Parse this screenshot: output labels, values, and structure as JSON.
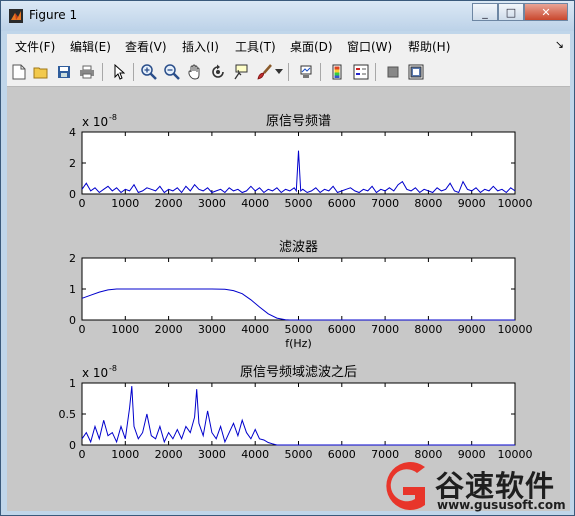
{
  "window": {
    "title": "Figure 1",
    "buttons": {
      "minimize": "_",
      "maximize": "□",
      "close": "✕"
    }
  },
  "menu": {
    "items": [
      "文件(F)",
      "编辑(E)",
      "查看(V)",
      "插入(I)",
      "工具(T)",
      "桌面(D)",
      "窗口(W)",
      "帮助(H)"
    ],
    "dock": "↘"
  },
  "toolbar": {
    "icons": [
      "new-figure-icon",
      "open-file-icon",
      "save-icon",
      "print-icon",
      "pointer-icon",
      "zoom-in-icon",
      "zoom-out-icon",
      "pan-hand-icon",
      "rotate-3d-icon",
      "data-cursor-icon",
      "brush-icon",
      "brush-dropdown-icon",
      "link-plot-icon",
      "colorbar-icon",
      "legend-icon",
      "hide-plot-tools-icon",
      "show-plot-tools-icon"
    ]
  },
  "colors": {
    "plot_line": "#0000cc",
    "background": "#c8c8c8",
    "axes_bg": "#ffffff"
  },
  "watermark": {
    "name": "谷速软件",
    "url": "www.gususoft.com"
  },
  "chart_data": [
    {
      "type": "line",
      "title": "原信号频谱",
      "xlabel": "",
      "ylabel": "",
      "exponent_label": "x 10",
      "exponent": "-8",
      "xlim": [
        0,
        10000
      ],
      "ylim": [
        0,
        4
      ],
      "xticks": [
        0,
        1000,
        2000,
        3000,
        4000,
        5000,
        6000,
        7000,
        8000,
        9000,
        10000
      ],
      "yticks": [
        0,
        2,
        4
      ],
      "series": [
        {
          "x": [
            0,
            100,
            200,
            300,
            400,
            500,
            600,
            700,
            800,
            900,
            1000,
            1100,
            1200,
            1300,
            1400,
            1500,
            1600,
            1700,
            1800,
            1900,
            2000,
            2100,
            2200,
            2300,
            2400,
            2500,
            2600,
            2700,
            2800,
            2900,
            3000,
            3100,
            3200,
            3300,
            3400,
            3500,
            3600,
            3700,
            3800,
            3900,
            4000,
            4100,
            4200,
            4300,
            4400,
            4500,
            4600,
            4700,
            4800,
            4900,
            4950,
            5000,
            5050,
            5100,
            5200,
            5300,
            5400,
            5500,
            5600,
            5700,
            5800,
            5900,
            6000,
            6100,
            6200,
            6300,
            6400,
            6500,
            6600,
            6700,
            6800,
            6900,
            7000,
            7100,
            7200,
            7300,
            7400,
            7500,
            7600,
            7700,
            7800,
            7900,
            8000,
            8100,
            8200,
            8300,
            8400,
            8500,
            8600,
            8700,
            8800,
            8900,
            9000,
            9100,
            9200,
            9300,
            9400,
            9500,
            9600,
            9700,
            9800,
            9900,
            10000
          ],
          "values": [
            0.3,
            0.7,
            0.2,
            0.4,
            0.1,
            0.3,
            0.5,
            0.2,
            0.4,
            0.1,
            0.3,
            0.2,
            0.6,
            0.1,
            0.2,
            0.4,
            0.3,
            0.2,
            0.5,
            0.1,
            0.3,
            0.2,
            0.4,
            0.1,
            0.5,
            0.2,
            0.6,
            0.3,
            0.2,
            0.4,
            0.1,
            0.2,
            0.3,
            0.1,
            0.4,
            0.2,
            0.3,
            0.1,
            0.2,
            0.5,
            0.2,
            0.4,
            0.1,
            0.3,
            0.2,
            0.4,
            0.1,
            0.3,
            0.2,
            0.4,
            0.2,
            2.8,
            0.2,
            0.3,
            0.1,
            0.2,
            0.4,
            0.1,
            0.3,
            0.2,
            0.5,
            0.1,
            0.2,
            0.3,
            0.4,
            0.2,
            0.1,
            0.3,
            0.2,
            0.5,
            0.1,
            0.3,
            0.2,
            0.4,
            0.2,
            0.6,
            0.8,
            0.3,
            0.2,
            0.4,
            0.1,
            0.3,
            0.2,
            0.1,
            0.4,
            0.2,
            0.3,
            0.7,
            0.2,
            0.1,
            0.8,
            0.3,
            0.2,
            0.4,
            0.1,
            0.3,
            0.2,
            0.5,
            0.2,
            0.3,
            0.1,
            0.4,
            0.2
          ]
        }
      ]
    },
    {
      "type": "line",
      "title": "滤波器",
      "xlabel": "f(Hz)",
      "ylabel": "",
      "xlim": [
        0,
        10000
      ],
      "ylim": [
        0,
        2
      ],
      "xticks": [
        0,
        1000,
        2000,
        3000,
        4000,
        5000,
        6000,
        7000,
        8000,
        9000,
        10000
      ],
      "yticks": [
        0,
        1,
        2
      ],
      "series": [
        {
          "x": [
            0,
            200,
            400,
            600,
            800,
            1000,
            1500,
            2000,
            2500,
            3000,
            3300,
            3500,
            3700,
            3900,
            4100,
            4300,
            4500,
            4700,
            4800,
            5000,
            6000,
            7000,
            8000,
            9000,
            10000
          ],
          "values": [
            0.7,
            0.8,
            0.9,
            0.97,
            1.0,
            1.0,
            1.0,
            1.0,
            1.0,
            1.0,
            0.99,
            0.95,
            0.85,
            0.65,
            0.42,
            0.2,
            0.06,
            0.01,
            0.0,
            0.0,
            0.0,
            0.0,
            0.0,
            0.0,
            0.0
          ]
        }
      ]
    },
    {
      "type": "line",
      "title": "原信号频域滤波之后",
      "xlabel": "",
      "ylabel": "",
      "exponent_label": "x 10",
      "exponent": "-8",
      "xlim": [
        0,
        10000
      ],
      "ylim": [
        0,
        1
      ],
      "xticks": [
        0,
        1000,
        2000,
        3000,
        4000,
        5000,
        6000,
        7000,
        8000,
        9000,
        10000
      ],
      "yticks": [
        0,
        0.5,
        1
      ],
      "series": [
        {
          "x": [
            0,
            100,
            200,
            300,
            400,
            500,
            600,
            700,
            800,
            900,
            1000,
            1100,
            1150,
            1200,
            1300,
            1400,
            1500,
            1600,
            1700,
            1800,
            1900,
            2000,
            2100,
            2200,
            2300,
            2400,
            2500,
            2600,
            2650,
            2700,
            2800,
            2900,
            3000,
            3100,
            3200,
            3300,
            3400,
            3500,
            3600,
            3700,
            3800,
            3900,
            4000,
            4100,
            4200,
            4300,
            4400,
            4500,
            5000,
            6000,
            7000,
            8000,
            9000,
            10000
          ],
          "values": [
            0.1,
            0.2,
            0.05,
            0.3,
            0.1,
            0.4,
            0.15,
            0.2,
            0.05,
            0.3,
            0.1,
            0.6,
            0.95,
            0.3,
            0.1,
            0.2,
            0.5,
            0.15,
            0.1,
            0.3,
            0.05,
            0.2,
            0.1,
            0.25,
            0.1,
            0.3,
            0.2,
            0.45,
            0.9,
            0.35,
            0.15,
            0.55,
            0.2,
            0.1,
            0.3,
            0.05,
            0.2,
            0.35,
            0.15,
            0.4,
            0.2,
            0.1,
            0.25,
            0.1,
            0.08,
            0.04,
            0.02,
            0.0,
            0.0,
            0.0,
            0.0,
            0.0,
            0.0,
            0.0
          ]
        }
      ]
    }
  ]
}
